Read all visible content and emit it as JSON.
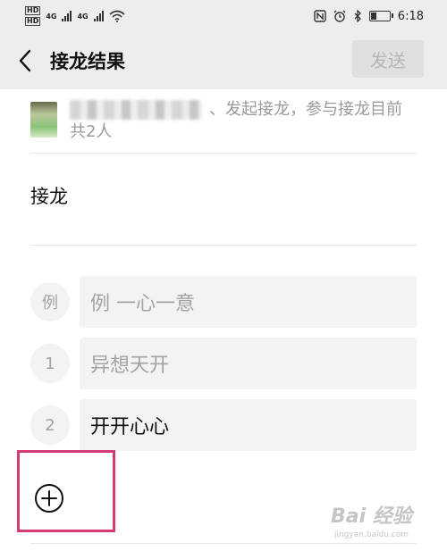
{
  "status_bar": {
    "hd1": "HD",
    "hd2": "HD",
    "net1": "4G",
    "net2": "4G",
    "time": "6:18"
  },
  "header": {
    "title": "接龙结果",
    "send_label": "发送"
  },
  "initiator": {
    "text": "、发起接龙，参与接龙目前共2人"
  },
  "topic": {
    "text": "接龙"
  },
  "entries": [
    {
      "num": "例",
      "text": "例 一心一意",
      "kind": "placeholder"
    },
    {
      "num": "1",
      "text": "异想天开",
      "kind": "placeholder"
    },
    {
      "num": "2",
      "text": "开开心心",
      "kind": "value"
    }
  ],
  "watermark": {
    "main": "Bai 经验",
    "sub": "jingyan.baidu.com"
  },
  "colors": {
    "header_bg": "#ededed",
    "highlight": "#d63b78",
    "send_disabled_bg": "#e0e0e0",
    "send_disabled_text": "#b6b6b6"
  }
}
